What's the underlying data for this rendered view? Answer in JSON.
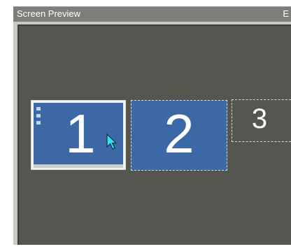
{
  "window": {
    "title": "Screen Preview",
    "title_corner": "E"
  },
  "screens": [
    {
      "label": "1",
      "state": "current"
    },
    {
      "label": "2",
      "state": "secondary"
    },
    {
      "label": "3",
      "state": "empty"
    }
  ],
  "colors": {
    "canvas": "#55564f",
    "screen_blue": "#3c69a5",
    "titlebar": "#7d7d7a",
    "cursor": "#33e0f0"
  },
  "icons": {
    "pointer": "mouse-pointer-icon"
  }
}
